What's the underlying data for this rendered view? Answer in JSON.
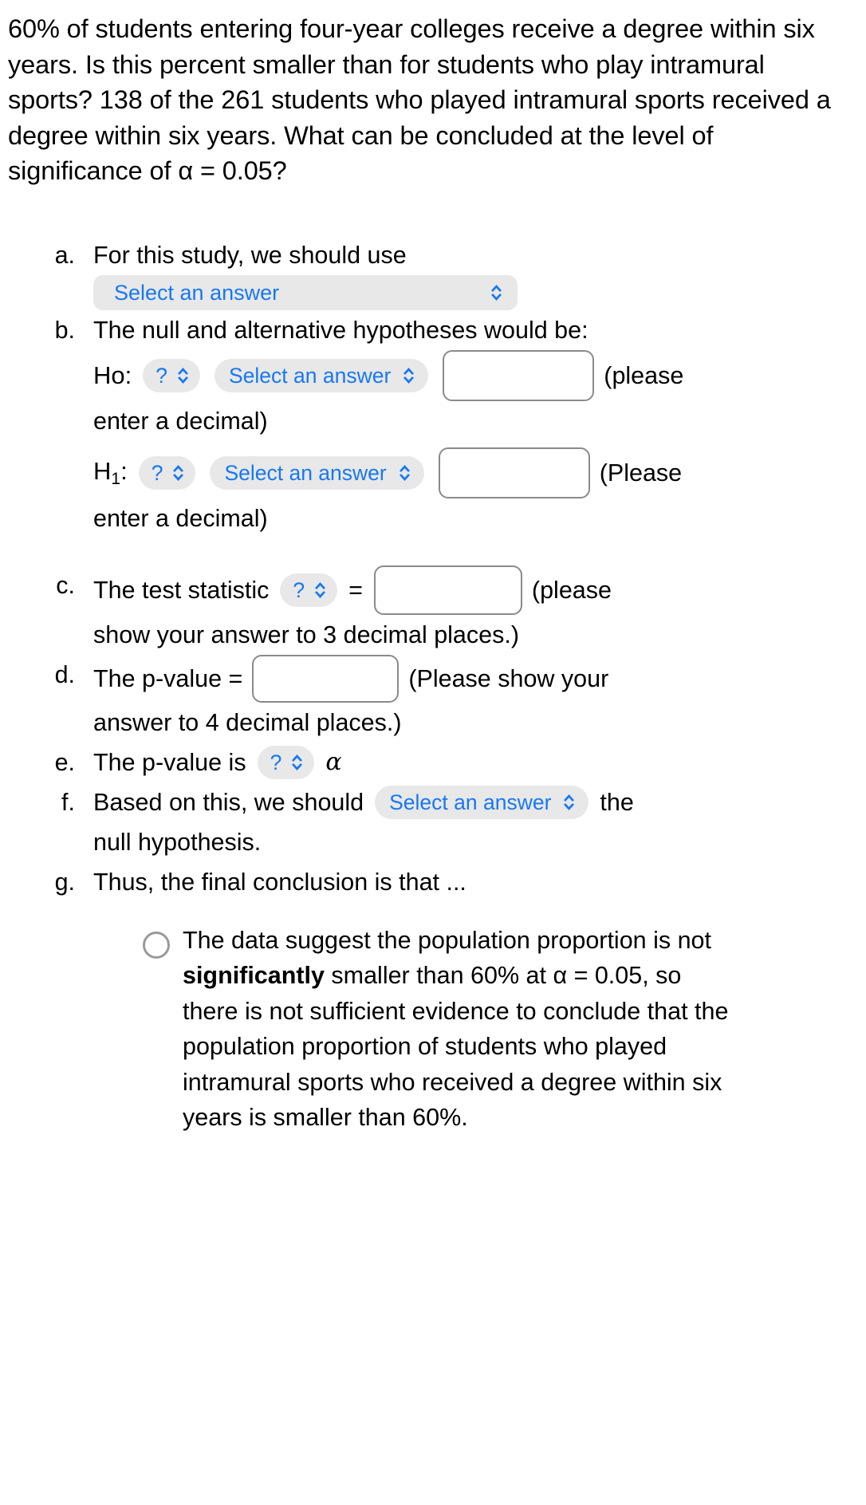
{
  "problem": {
    "statement": "60% of students entering four-year colleges receive a degree within six years. Is this percent smaller than for students who play intramural sports? 138 of the 261 students who played intramural sports received a degree within six years. What can be concluded at the level of significance of α = 0.05?",
    "percent_baseline": "60%",
    "successes": "138",
    "sample_size": "261",
    "alpha": "0.05"
  },
  "labels": {
    "select_an_answer": "Select an answer",
    "question_mark": "?",
    "equals": "=",
    "alpha_symbol": "α",
    "chevron_icon": "chevron-up-down-icon"
  },
  "parts": {
    "a": {
      "marker": "a.",
      "text": "For this study, we should use",
      "select_value": "Select an answer"
    },
    "b": {
      "marker": "b.",
      "text": "The null and alternative hypotheses would be:",
      "ho": {
        "label": "Ho:",
        "param_value": "?",
        "operator_value": "Select an answer",
        "input_value": "",
        "hint_line1": "(please",
        "hint_line2": "enter a decimal)"
      },
      "h1": {
        "label_main": "H",
        "label_sub": "1",
        "label_colon": ":",
        "param_value": "?",
        "operator_value": "Select an answer",
        "input_value": "",
        "hint_line1": "(Please",
        "hint_line2": "enter a decimal)"
      }
    },
    "c": {
      "marker": "c.",
      "text": "The test statistic",
      "param_value": "?",
      "equals": "=",
      "input_value": "",
      "hint_line1": "(please",
      "hint_line2": "show your answer to 3 decimal places.)"
    },
    "d": {
      "marker": "d.",
      "text": "The p-value =",
      "input_value": "",
      "hint_line1": "(Please show your",
      "hint_line2": "answer to 4 decimal places.)"
    },
    "e": {
      "marker": "e.",
      "text": "The p-value is",
      "param_value": "?",
      "trailing": "α"
    },
    "f": {
      "marker": "f.",
      "text": "Based on this, we should",
      "select_value": "Select an answer",
      "trailing": "the",
      "text_line2": "null hypothesis."
    },
    "g": {
      "marker": "g.",
      "text": "Thus, the final conclusion is that ...",
      "options": [
        {
          "selected": false,
          "before_bold": "The data suggest the population proportion is not ",
          "bold": "significantly",
          "after_bold": " smaller than 60% at α = 0.05, so there is not sufficient evidence to conclude that the population proportion of students who played intramural sports who received a degree within six years is smaller than 60%."
        }
      ]
    }
  },
  "colors": {
    "accent_blue": "#1878f0",
    "pill_background": "#e8e8e8",
    "input_border": "#8a8a8a",
    "radio_border": "#9a9a9a",
    "text": "#000000"
  }
}
